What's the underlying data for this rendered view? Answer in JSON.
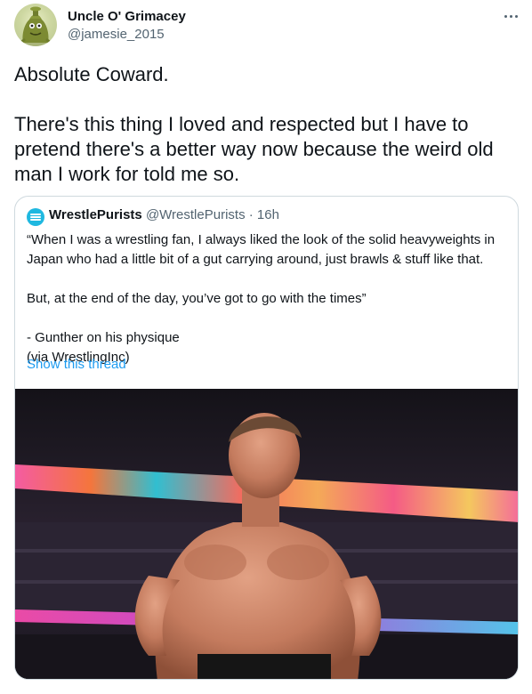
{
  "author": {
    "display_name": "Uncle O' Grimacey",
    "handle": "@jamesie_2015",
    "avatar_icon": "grimace-character-avatar"
  },
  "more_icon": "ellipsis-icon",
  "tweet": {
    "paragraphs": [
      "Absolute Coward.",
      "There's this thing I loved and respected but I have to pretend there's a better way now because the weird old man I work for told me so."
    ]
  },
  "quote": {
    "author_name": "WrestlePurists",
    "author_handle": "@WrestlePurists",
    "separator": "·",
    "time": "16h",
    "avatar_color": "#1fb8e0",
    "lines": [
      "“When I was a wrestling fan, I always liked the look of the solid heavyweights in Japan who had a little bit of a gut carrying around, just brawls & stuff like that.",
      "But, at the end of the day, you’ve got to go with the times”",
      "- Gunther on his physique",
      "(via WrestlingInc)"
    ],
    "show_thread": "Show this thread",
    "media_icon": "wrestler-arena-photo"
  },
  "colors": {
    "text_primary": "#0f1419",
    "text_secondary": "#536471",
    "link": "#1d9bf0",
    "border": "#cfd9de"
  }
}
